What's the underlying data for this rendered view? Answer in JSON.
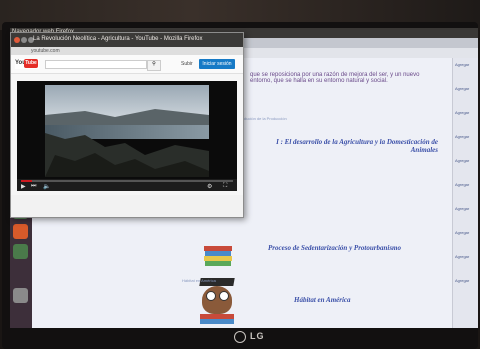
{
  "system": {
    "app_name": "Navegador web Firefox"
  },
  "popup": {
    "title": "La Revolución Neolítica - Agricultura - YouTube - Mozilla Firefox",
    "url": "youtube.com",
    "youtube_logo_you": "You",
    "youtube_logo_tube": "Tube",
    "search_icon": "search-icon",
    "upload_label": "Subir",
    "signin_label": "Iniciar sesión",
    "video_progress_fraction": 0.05
  },
  "page": {
    "intro_text": "que se reposiciona por una razón de mejora del ser, y un nuevo entorno, que se halla en su entorno natural y social.",
    "section1_label": "Revolución de la Producción",
    "section1_title": "I : El desarrollo de la Agricultura y la Domesticación de Animales",
    "section2_title": "Proceso de Sedentarización y Protourbanismo",
    "section3_label": "Hábitat en América",
    "section3_title": "Hábitat en América"
  },
  "sidebar_right": {
    "items": [
      "Agregar",
      "Agregar",
      "Agregar",
      "Agregar",
      "Agregar",
      "Agregar",
      "Agregar",
      "Agregar",
      "Agregar",
      "Agregar"
    ]
  },
  "monitor": {
    "brand": "LG"
  },
  "colors": {
    "accent": "#3a4fa8",
    "youtube_red": "#e52d27",
    "signin_blue": "#167ac6",
    "launcher": "#3d2f3a"
  }
}
